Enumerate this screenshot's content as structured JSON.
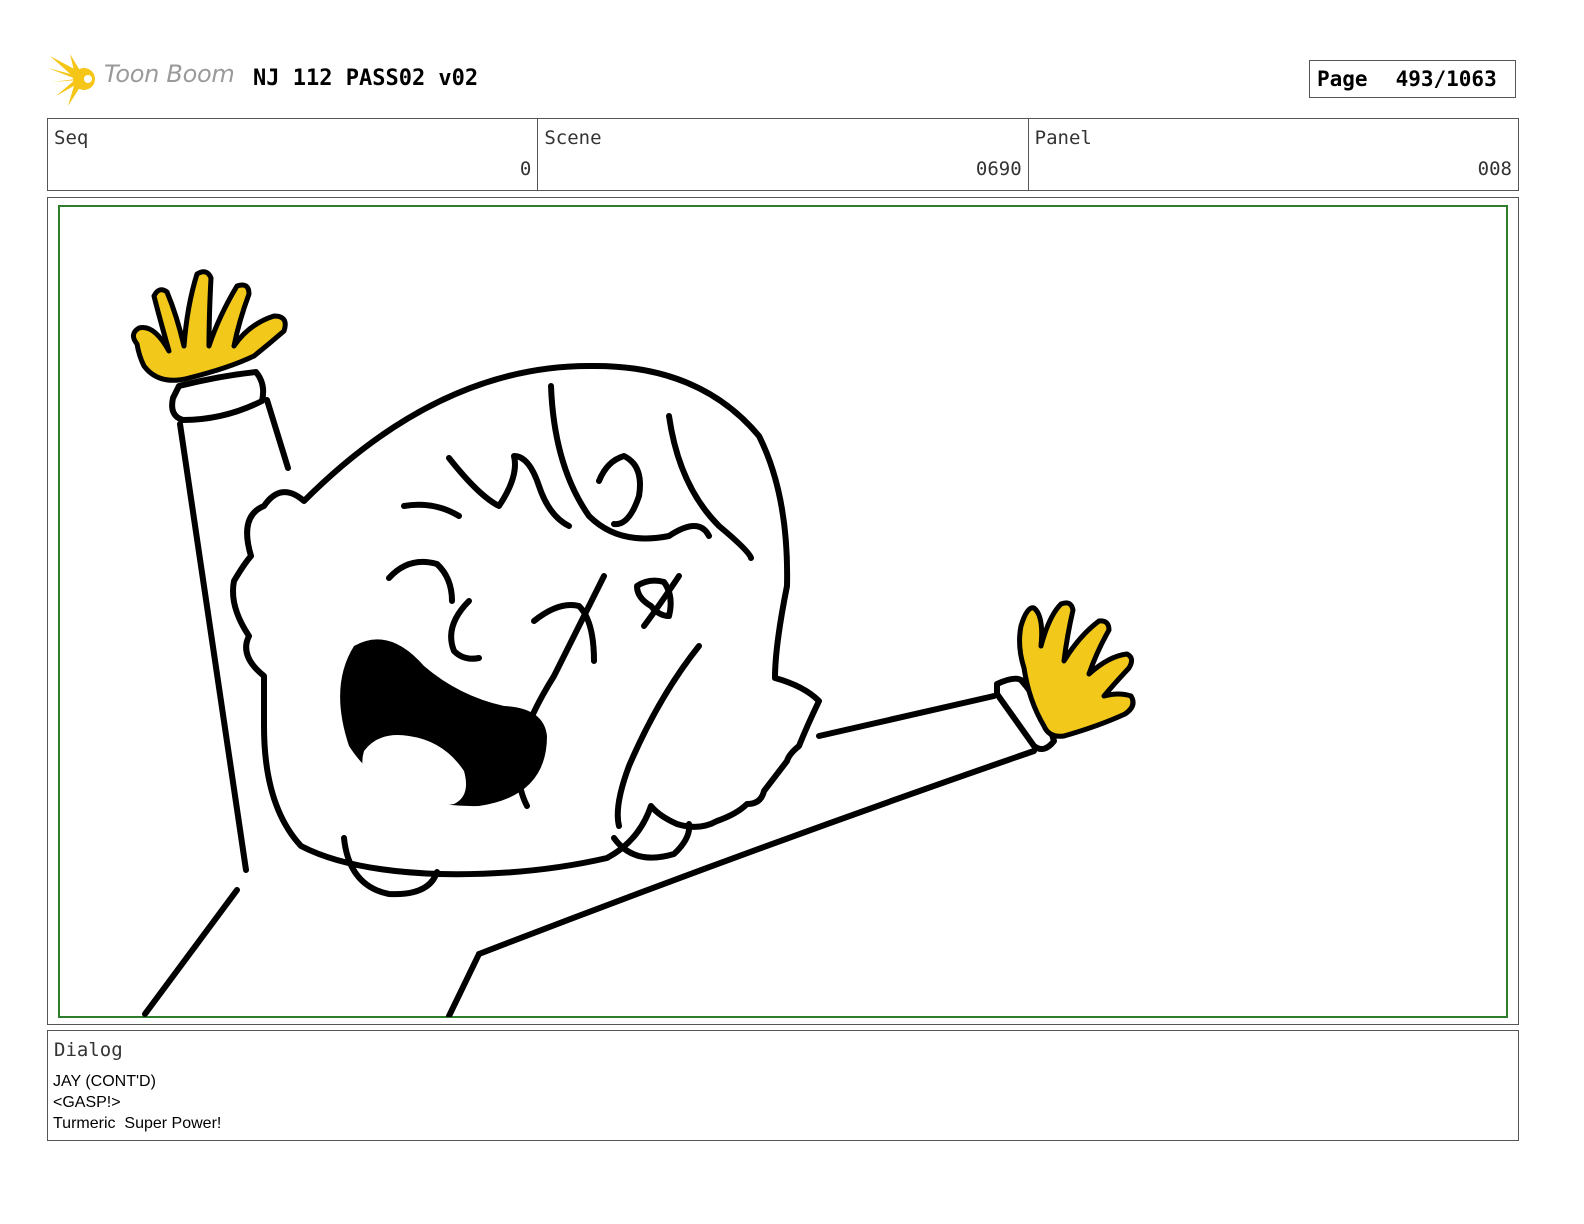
{
  "header": {
    "logo_text": "Toon Boom",
    "project_title": "NJ 112 PASS02 v02",
    "page_label": "Page",
    "page_value": "493/1063"
  },
  "info": {
    "seq_label": "Seq",
    "seq_value": "0",
    "scene_label": "Scene",
    "scene_value": "0690",
    "panel_label": "Panel",
    "panel_value": "008"
  },
  "dialog": {
    "label": "Dialog",
    "lines": [
      "JAY (CONT'D)",
      "<GASP!>",
      "Turmeric  Super Power!"
    ]
  },
  "colors": {
    "frame_green": "#2d7d2d",
    "glove_yellow": "#f2c81b",
    "logo_yellow": "#f5c518"
  },
  "illustration": {
    "subject": "cartoon child with both arms raised wearing yellow gloves"
  }
}
